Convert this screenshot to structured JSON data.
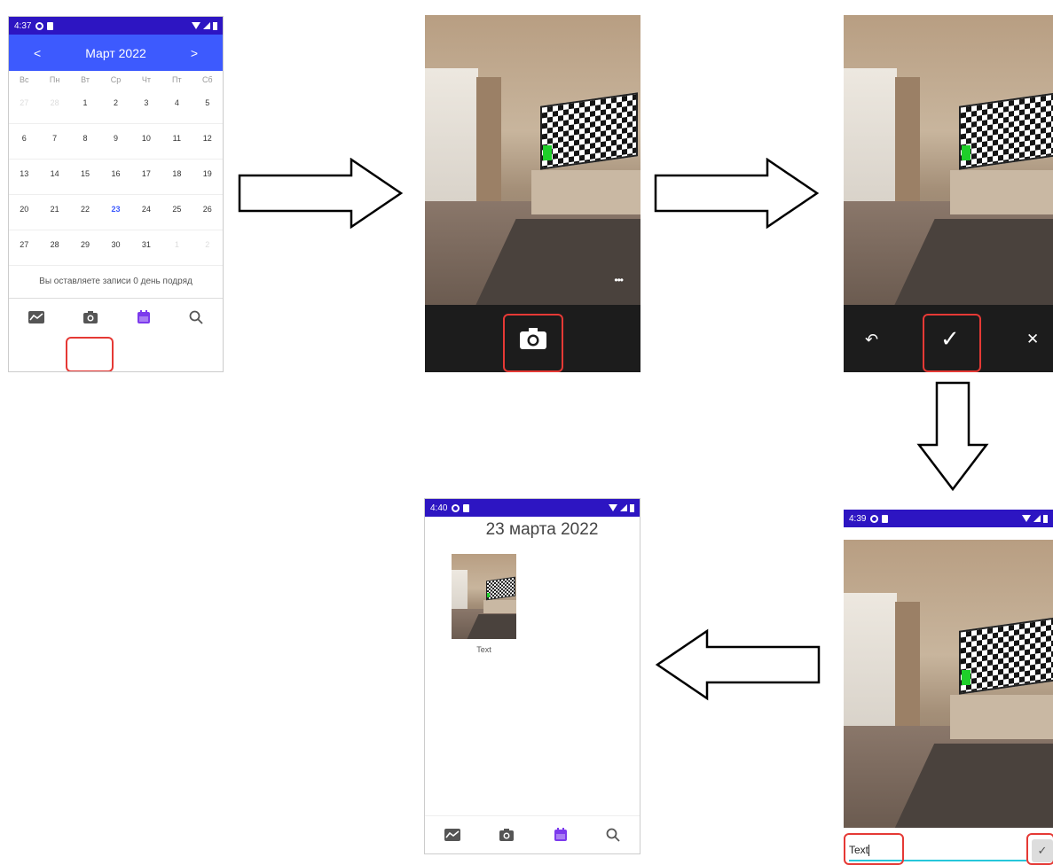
{
  "status": {
    "screen1_time": "4:37",
    "screen4_time": "4:39",
    "screen5_time": "4:40"
  },
  "calendar": {
    "prev": "<",
    "next": ">",
    "month_title": "Март 2022",
    "days_of_week": [
      "Вс",
      "Пн",
      "Вт",
      "Ср",
      "Чт",
      "Пт",
      "Сб"
    ],
    "weeks": [
      [
        "27",
        "28",
        "1",
        "2",
        "3",
        "4",
        "5"
      ],
      [
        "6",
        "7",
        "8",
        "9",
        "10",
        "11",
        "12"
      ],
      [
        "13",
        "14",
        "15",
        "16",
        "17",
        "18",
        "19"
      ],
      [
        "20",
        "21",
        "22",
        "23",
        "24",
        "25",
        "26"
      ],
      [
        "27",
        "28",
        "29",
        "30",
        "31",
        "1",
        "2"
      ]
    ],
    "today": "23",
    "streak_text": "Вы оставляете записи 0 день подряд"
  },
  "nav": {
    "items": [
      "chart-icon",
      "camera-icon",
      "calendar-icon",
      "search-icon"
    ],
    "active_color": "#7c3aed"
  },
  "camera": {
    "more_menu": "•••"
  },
  "review": {
    "undo": "↶",
    "confirm": "✓",
    "cancel": "✕"
  },
  "caption_editor": {
    "input_value": "Text",
    "submit": "✓"
  },
  "day_view": {
    "title": "23 марта 2022",
    "entry_caption": "Text"
  },
  "colors": {
    "status_bar": "#2d15c2",
    "header_blue": "#3d5afe",
    "highlight_red": "#e53935",
    "today_blue": "#3d5afe"
  }
}
